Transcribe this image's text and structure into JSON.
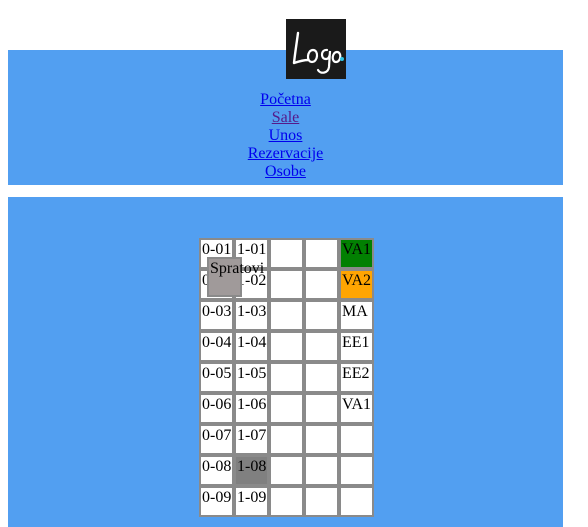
{
  "logo": {
    "text": "Logo"
  },
  "nav": {
    "items": [
      {
        "label": "Početna",
        "visited": false
      },
      {
        "label": "Sale",
        "visited": true
      },
      {
        "label": "Unos",
        "visited": false
      },
      {
        "label": "Rezervacije",
        "visited": false
      },
      {
        "label": "Osobe",
        "visited": false
      }
    ]
  },
  "floors": {
    "header": "Spratovi",
    "rows": [
      {
        "c0": "0-01",
        "c1": "1-01",
        "c2": "",
        "c3": "",
        "c4": "VA1",
        "c4_color": "#028002"
      },
      {
        "c0": "0-02",
        "c1": "1-02",
        "c2": "",
        "c3": "",
        "c4": "VA2",
        "c4_color": "#ffa502"
      },
      {
        "c0": "0-03",
        "c1": "1-03",
        "c2": "",
        "c3": "",
        "c4": "MA"
      },
      {
        "c0": "0-04",
        "c1": "1-04",
        "c2": "",
        "c3": "",
        "c4": "EE1"
      },
      {
        "c0": "0-05",
        "c1": "1-05",
        "c2": "",
        "c3": "",
        "c4": "EE2"
      },
      {
        "c0": "0-06",
        "c1": "1-06",
        "c2": "",
        "c3": "",
        "c4": "VA1"
      },
      {
        "c0": "0-07",
        "c1": "1-07",
        "c2": "",
        "c3": "",
        "c4": ""
      },
      {
        "c0": "0-08",
        "c1": "1-08",
        "c1_color": "#808080",
        "c2": "",
        "c3": "",
        "c4": ""
      },
      {
        "c0": "0-09",
        "c1": "1-09",
        "c2": "",
        "c3": "",
        "c4": ""
      }
    ]
  }
}
